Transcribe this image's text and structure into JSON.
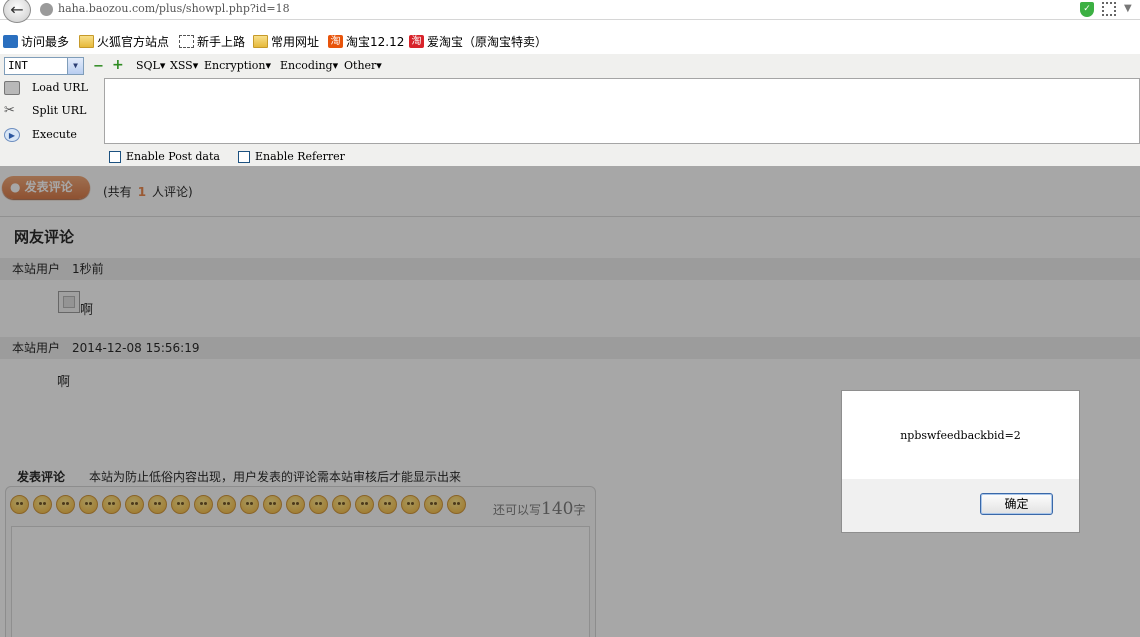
{
  "browser": {
    "url": "haha.baozou.com/plus/showpl.php?id=18",
    "back_glyph": "←",
    "shield_glyph": "✓",
    "menu_glyph": "▼"
  },
  "bookmarks": [
    {
      "label": "访问最多",
      "icon": "search-icon"
    },
    {
      "label": "火狐官方站点",
      "icon": "folder-icon"
    },
    {
      "label": "新手上路",
      "icon": "dashed-box-icon"
    },
    {
      "label": "常用网址",
      "icon": "folder-icon"
    },
    {
      "label": "淘宝12.12",
      "icon": "taobao-icon"
    },
    {
      "label": "爱淘宝（原淘宝特卖）",
      "icon": "taobao-icon"
    }
  ],
  "hackbar": {
    "select_value": "INT",
    "minus": "−",
    "plus": "+",
    "menus": [
      "SQL",
      "XSS",
      "Encryption",
      "Encoding",
      "Other"
    ],
    "load_url": "Load URL",
    "split_url": "Split URL",
    "execute": "Execute",
    "enable_post": "Enable Post data",
    "enable_referrer": "Enable Referrer"
  },
  "page": {
    "post_button": "发表评论",
    "count_prefix": "(共有",
    "count_number": "1",
    "count_suffix": "人评论)",
    "section_title": "网友评论",
    "comments": [
      {
        "user": "本站用户",
        "time": "1秒前",
        "text": "啊"
      },
      {
        "user": "本站用户",
        "time": "2014-12-08 15:56:19",
        "text": "啊"
      }
    ],
    "post_label": "发表评论",
    "post_note": "本站为防止低俗内容出现，用户发表的评论需本站审核后才能显示出来",
    "remain_prefix": "还可以写",
    "remain_number": "140",
    "remain_suffix": "字"
  },
  "dialog": {
    "message": "npbswfeedbackbid=2",
    "ok": "确定"
  },
  "colors": {
    "post_button": "#d8703a",
    "count_number": "#e8742e",
    "overlay": "rgba(60,60,60,0.45)"
  }
}
